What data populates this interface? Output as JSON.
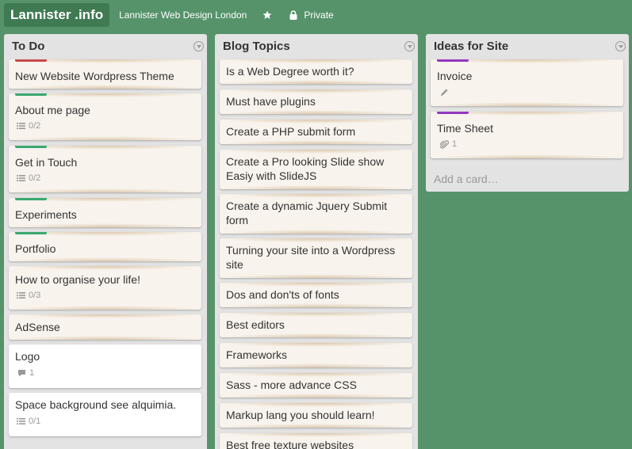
{
  "header": {
    "logo": "Lannister .info",
    "org": "Lannister Web Design London",
    "visibility": "Private"
  },
  "colors": {
    "red": "#c8494a",
    "green": "#3aa870",
    "purple": "#9438c1"
  },
  "lists": [
    {
      "title": "To Do",
      "cards": [
        {
          "title": "New Website Wordpress Theme",
          "label": "red"
        },
        {
          "title": "About me page",
          "label": "green",
          "badge_icon": "checklist-icon",
          "badge": "0/2"
        },
        {
          "title": "Get in Touch",
          "label": "green",
          "badge_icon": "checklist-icon",
          "badge": "0/2"
        },
        {
          "title": "Experiments",
          "label": "green"
        },
        {
          "title": "Portfolio",
          "label": "green"
        },
        {
          "title": "How to organise your life!",
          "badge_icon": "checklist-icon",
          "badge": "0/3"
        },
        {
          "title": "AdSense"
        },
        {
          "title": "Logo",
          "badge_icon": "comment-icon",
          "badge": "1"
        },
        {
          "title": "Space background see alquimia.",
          "badge_icon": "checklist-icon",
          "badge": "0/1"
        }
      ]
    },
    {
      "title": "Blog Topics",
      "cards": [
        {
          "title": "Is a Web Degree worth it?"
        },
        {
          "title": "Must have plugins"
        },
        {
          "title": "Create a PHP submit form"
        },
        {
          "title": "Create a Pro looking Slide show Easiy with SlideJS"
        },
        {
          "title": "Create a dynamic Jquery Submit form"
        },
        {
          "title": "Turning your site into a Wordpress site"
        },
        {
          "title": "Dos and don'ts of fonts"
        },
        {
          "title": "Best editors"
        },
        {
          "title": "Frameworks"
        },
        {
          "title": "Sass - more advance CSS"
        },
        {
          "title": "Markup lang you should learn!"
        },
        {
          "title": "Best free texture websites"
        }
      ]
    },
    {
      "title": "Ideas for Site",
      "cards": [
        {
          "title": "Invoice",
          "label": "purple",
          "badge_icon": "pencil-icon"
        },
        {
          "title": "Time Sheet",
          "label": "purple",
          "badge_icon": "attachment-icon",
          "badge": "1"
        }
      ],
      "add_card": "Add a card…"
    }
  ]
}
